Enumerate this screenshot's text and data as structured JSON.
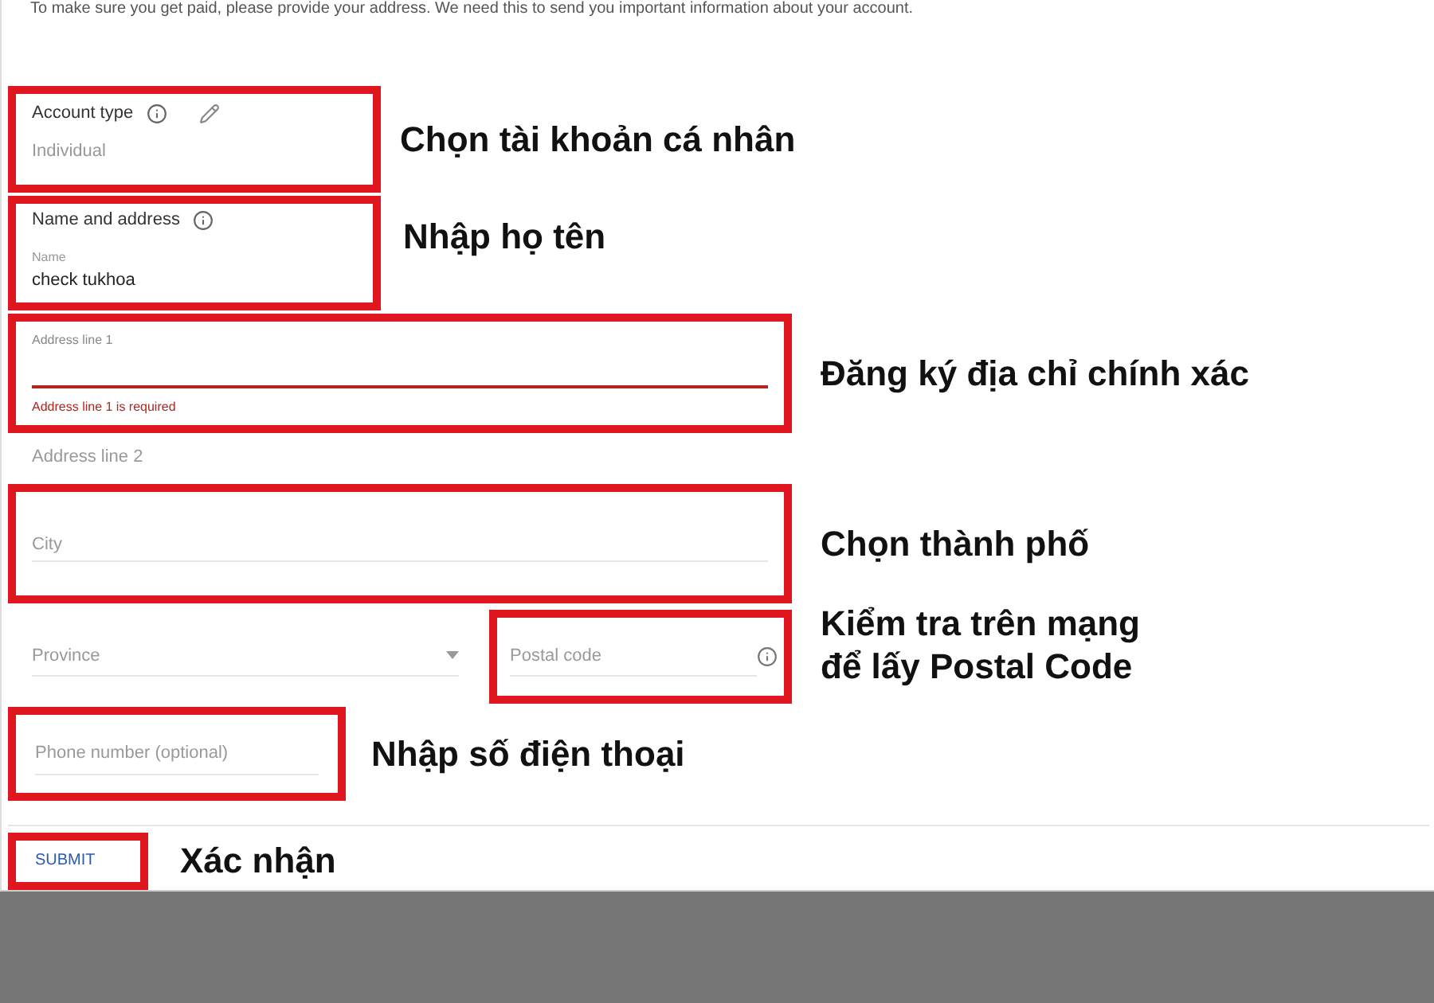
{
  "intro": "To make sure you get paid, please provide your address. We need this to send you important information about your account.",
  "fields": [
    {
      "kind": "static",
      "label": "Account type",
      "value": "Individual",
      "highlighted": true,
      "note": "Chọn tài khoản cá nhân"
    },
    {
      "kind": "name",
      "label": "Name and address",
      "field_label": "Name",
      "value": "check tukhoa",
      "highlighted": true,
      "note": "Nhập họ tên"
    },
    {
      "kind": "text",
      "label": "Address line 1",
      "error": "Address line 1 is required",
      "highlighted": true,
      "note": "Đăng ký địa chỉ chính xác"
    },
    {
      "kind": "plain",
      "placeholder": "Address line 2"
    },
    {
      "kind": "text",
      "placeholder": "City",
      "highlighted": true,
      "note": "Chọn thành phố"
    },
    {
      "kind": "pair",
      "left": {
        "placeholder": "Province"
      },
      "right": {
        "placeholder": "Postal code",
        "highlighted": true
      },
      "note": "Kiểm tra trên mạng để lấy Postal Code"
    },
    {
      "kind": "short",
      "placeholder": "Phone number (optional)",
      "highlighted": true,
      "note": "Nhập số điện thoại"
    }
  ],
  "submit": {
    "label": "SUBMIT",
    "highlighted": true,
    "note": "Xác nhận"
  }
}
